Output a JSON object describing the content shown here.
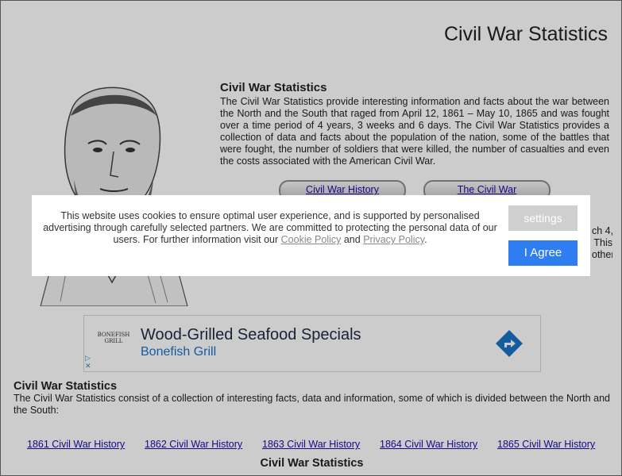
{
  "page": {
    "title": "Civil War Statistics"
  },
  "intro": {
    "heading": "Civil War Statistics",
    "body": "The Civil War Statistics provide interesting information and facts about the war between the North and the South that raged from April 12, 1861 – May 10, 1865 and was fought over a time period of 4 years, 3 weeks and 6 days. The Civil War Statistics provides a collection of data and facts about the population of the nation, some of the battles that were fought, the number of soldiers that were killed, the number of casualties and even the costs associated with the American Civil War."
  },
  "pills": {
    "history": "Civil War History",
    "war": "The Civil War"
  },
  "obscured_text": {
    "line1": "ch 4,",
    "line2": "This",
    "line3": "other"
  },
  "ad": {
    "logo_text": "BONEFISH GRILL",
    "headline": "Wood-Grilled Seafood Specials",
    "brand": "Bonefish Grill",
    "adchoices": "▷\n✕"
  },
  "section2": {
    "heading": "Civil War Statistics",
    "body": "The Civil War Statistics consist of a collection of interesting facts, data and information, some of which is divided between the North and the South:"
  },
  "year_links": [
    "1861 Civil War History",
    "1862 Civil War History",
    "1863 Civil War History",
    "1864 Civil War History",
    "1865 Civil War History"
  ],
  "footer_heading": "Civil War Statistics",
  "cookie": {
    "text_before": "This website uses cookies to ensure optimal user experience, and is supported by personalised advertising through carefully selected partners. We are committed to protecting the personal data of our users. For further information visit our ",
    "cookie_policy": "Cookie Policy",
    "and": " and ",
    "privacy_policy": "Privacy Policy",
    "period": ".",
    "settings_label": "settings",
    "agree_label": "I Agree"
  },
  "colors": {
    "agree_button": "#2e7ef2",
    "settings_button": "#cfcfcf",
    "link": "#1a0dab",
    "ad_brand": "#1a73c7"
  }
}
